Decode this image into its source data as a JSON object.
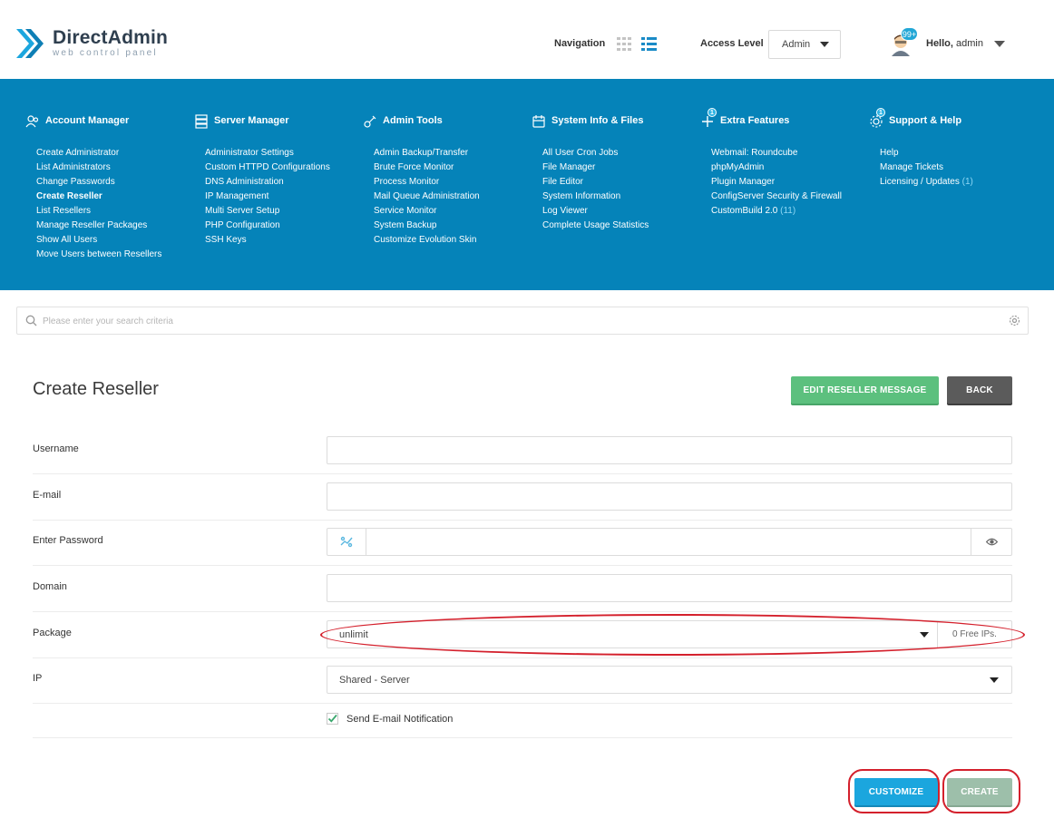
{
  "brand": {
    "name": "DirectAdmin",
    "tagline": "web control panel"
  },
  "header": {
    "navigation_label": "Navigation",
    "access_level_label": "Access Level",
    "access_level_value": "Admin",
    "notifications_badge": "99+",
    "greeting": "Hello,",
    "username": "admin"
  },
  "menu": {
    "columns": [
      {
        "title": "Account Manager",
        "icon": "users-icon",
        "items": [
          "Create Administrator",
          "List Administrators",
          "Change Passwords",
          "Create Reseller",
          "List Resellers",
          "Manage Reseller Packages",
          "Show All Users",
          "Move Users between Resellers"
        ],
        "active": "Create Reseller"
      },
      {
        "title": "Server Manager",
        "icon": "server-icon",
        "items": [
          "Administrator Settings",
          "Custom HTTPD Configurations",
          "DNS Administration",
          "IP Management",
          "Multi Server Setup",
          "PHP Configuration",
          "SSH Keys"
        ]
      },
      {
        "title": "Admin Tools",
        "icon": "tools-icon",
        "items": [
          "Admin Backup/Transfer",
          "Brute Force Monitor",
          "Process Monitor",
          "Mail Queue Administration",
          "Service Monitor",
          "System Backup",
          "Customize Evolution Skin"
        ]
      },
      {
        "title": "System Info & Files",
        "icon": "files-icon",
        "items": [
          "All User Cron Jobs",
          "File Manager",
          "File Editor",
          "System Information",
          "Log Viewer",
          "Complete Usage Statistics"
        ]
      },
      {
        "title": "Extra Features",
        "icon": "plus-icon",
        "badge": "1",
        "items": [
          "Webmail: Roundcube",
          "phpMyAdmin",
          "Plugin Manager",
          "ConfigServer Security & Firewall",
          "CustomBuild 2.0"
        ],
        "counts": {
          "CustomBuild 2.0": "(11)"
        }
      },
      {
        "title": "Support & Help",
        "icon": "gear-icon",
        "badge": "1",
        "items": [
          "Help",
          "Manage Tickets",
          "Licensing / Updates"
        ],
        "counts": {
          "Licensing / Updates": "(1)"
        }
      }
    ]
  },
  "search": {
    "placeholder": "Please enter your search criteria"
  },
  "page": {
    "title": "Create Reseller",
    "edit_message_button": "EDIT RESELLER MESSAGE",
    "back_button": "BACK"
  },
  "form": {
    "username_label": "Username",
    "email_label": "E-mail",
    "password_label": "Enter Password",
    "domain_label": "Domain",
    "package_label": "Package",
    "package_value": "unlimit",
    "free_ips": "0 Free IPs.",
    "ip_label": "IP",
    "ip_value": "Shared - Server",
    "notify_label": "Send E-mail Notification",
    "notify_checked": true,
    "customize_button": "CUSTOMIZE",
    "create_button": "CREATE"
  },
  "colors": {
    "menu_bg": "#0583b9",
    "accent": "#1ba6de",
    "green": "#5cc07e",
    "annotation": "#d4202c"
  }
}
